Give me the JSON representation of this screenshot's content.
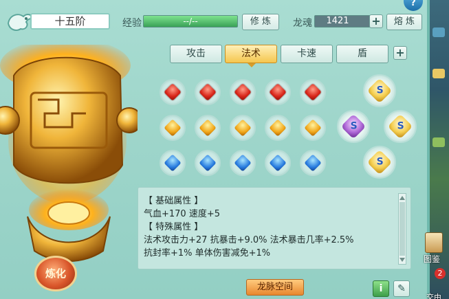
{
  "header": {
    "rank": "十五阶",
    "exp_label": "经验",
    "exp_value": "--/--",
    "refine_btn": "修 炼",
    "soul_label": "龙魂",
    "soul_value": "1421",
    "smelt_btn": "熔 炼"
  },
  "tabs": [
    {
      "label": "攻击",
      "active": false
    },
    {
      "label": "法术",
      "active": true
    },
    {
      "label": "卡速",
      "active": false
    },
    {
      "label": "盾",
      "active": false
    }
  ],
  "info": {
    "lines": [
      "【 基础属性 】",
      "气血+170  速度+5",
      "【 特殊属性 】",
      "法术攻击力+27  抗暴击+9.0%  法术暴击几率+2.5%",
      "抗封率+1%  单体伤害减免+1%"
    ]
  },
  "actions": {
    "refine": "炼化",
    "dragon_space": "龙脉空间",
    "info_icon": "i",
    "help_icon": "?"
  },
  "side": {
    "book_label": "图鉴",
    "badge": "2",
    "bottom_text": "交由"
  },
  "colors": {
    "panel_bg": "#a9ddd2",
    "active_tab": "#f5c64e",
    "exp_bar": "#4fbf6a",
    "gem_red": "#d9261a",
    "gem_gold": "#f1a71a",
    "gem_blue": "#2a7ee0"
  }
}
